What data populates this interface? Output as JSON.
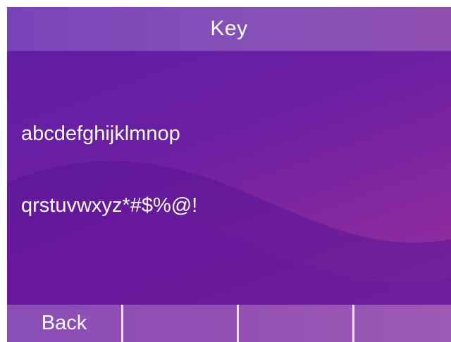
{
  "title": "Key",
  "keys": {
    "row1": "abcdefghijklmnop",
    "row2": "qrstuvwxyz*#$%@!"
  },
  "softkeys": [
    {
      "label": "Back"
    },
    {
      "label": ""
    },
    {
      "label": ""
    },
    {
      "label": ""
    }
  ],
  "colors": {
    "background_start": "#5e1ea6",
    "background_end": "#9a3a9e",
    "title_bar": "#8450b8",
    "softkey_bar": "#9350b3",
    "text": "#ffffff"
  }
}
